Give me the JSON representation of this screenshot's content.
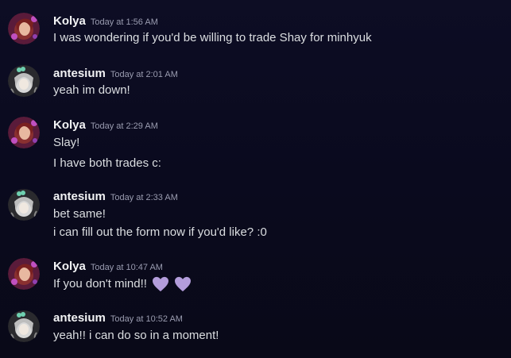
{
  "messages": [
    {
      "user": "Kolya",
      "time": "Today at 1:56 AM",
      "lines": [
        "I was wondering if you'd be willing to trade Shay for minhyuk"
      ]
    },
    {
      "user": "antesium",
      "time": "Today at 2:01 AM",
      "lines": [
        "yeah im down!"
      ]
    },
    {
      "user": "Kolya",
      "time": "Today at 2:29 AM",
      "lines": [
        "Slay!",
        "I have both trades c:"
      ]
    },
    {
      "user": "antesium",
      "time": "Today at 2:33 AM",
      "lines": [
        "bet same!",
        "i can fill out the form now if you'd like? :0"
      ]
    },
    {
      "user": "Kolya",
      "time": "Today at 10:47 AM",
      "lines": [
        "If you don't mind!!"
      ]
    },
    {
      "user": "antesium",
      "time": "Today at 10:52 AM",
      "lines": [
        "yeah!! i can do so in a moment!"
      ]
    }
  ],
  "colors": {
    "background": "#0b0b20",
    "username": "#f2f3f5",
    "timestamp": "#9a9cb0",
    "text": "#dbdee1",
    "heart": "#b39ddb"
  },
  "emoji": {
    "heart_icon_name": "purple-heart-icon"
  }
}
